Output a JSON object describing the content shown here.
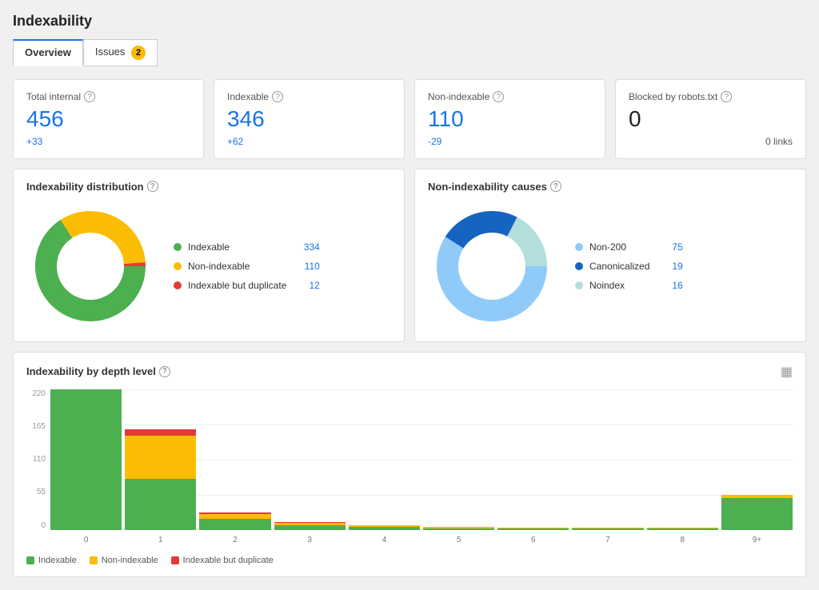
{
  "page": {
    "title": "Indexability"
  },
  "tabs": [
    {
      "id": "overview",
      "label": "Overview",
      "active": true,
      "badge": null
    },
    {
      "id": "issues",
      "label": "Issues",
      "active": false,
      "badge": "2"
    }
  ],
  "metrics": [
    {
      "id": "total-internal",
      "label": "Total internal",
      "value": "456",
      "change": "+33",
      "change_type": "positive",
      "sub": null
    },
    {
      "id": "indexable",
      "label": "Indexable",
      "value": "346",
      "change": "+62",
      "change_type": "positive",
      "sub": null
    },
    {
      "id": "non-indexable",
      "label": "Non-indexable",
      "value": "110",
      "change": "-29",
      "change_type": "negative",
      "sub": null
    },
    {
      "id": "blocked-by-robots",
      "label": "Blocked by robots.txt",
      "value": "0",
      "change": null,
      "change_type": null,
      "sub": "0 links"
    }
  ],
  "indexability_distribution": {
    "title": "Indexability distribution",
    "legend": [
      {
        "label": "Indexable",
        "value": "334",
        "color": "#4caf50"
      },
      {
        "label": "Non-indexable",
        "value": "110",
        "color": "#fbbc04"
      },
      {
        "label": "Indexable but duplicate",
        "value": "12",
        "color": "#e53935"
      }
    ],
    "donut": {
      "indexable_pct": 73.6,
      "non_indexable_pct": 24.2,
      "duplicate_pct": 2.6
    }
  },
  "non_indexability_causes": {
    "title": "Non-indexability causes",
    "legend": [
      {
        "label": "Non-200",
        "value": "75",
        "color": "#90caf9"
      },
      {
        "label": "Canonicalized",
        "value": "19",
        "color": "#1565c0"
      },
      {
        "label": "Noindex",
        "value": "16",
        "color": "#b2dfdb"
      }
    ],
    "donut": {
      "non200_pct": 68.2,
      "canonicalized_pct": 17.3,
      "noindex_pct": 14.5
    }
  },
  "bar_chart": {
    "title": "Indexability by depth level",
    "y_labels": [
      "220",
      "165",
      "110",
      "55",
      "0"
    ],
    "x_labels": [
      "0",
      "1",
      "2",
      "3",
      "4",
      "5",
      "6",
      "7",
      "8",
      "9+"
    ],
    "bars": [
      {
        "label": "0",
        "indexable": 220,
        "non_indexable": 0,
        "duplicate": 0
      },
      {
        "label": "1",
        "indexable": 80,
        "non_indexable": 68,
        "duplicate": 10
      },
      {
        "label": "2",
        "indexable": 18,
        "non_indexable": 8,
        "duplicate": 2
      },
      {
        "label": "3",
        "indexable": 8,
        "non_indexable": 4,
        "duplicate": 1
      },
      {
        "label": "4",
        "indexable": 5,
        "non_indexable": 3,
        "duplicate": 0
      },
      {
        "label": "5",
        "indexable": 3,
        "non_indexable": 2,
        "duplicate": 0
      },
      {
        "label": "6",
        "indexable": 2,
        "non_indexable": 1,
        "duplicate": 0
      },
      {
        "label": "7",
        "indexable": 2,
        "non_indexable": 1,
        "duplicate": 0
      },
      {
        "label": "8",
        "indexable": 2,
        "non_indexable": 1,
        "duplicate": 0
      },
      {
        "label": "9+",
        "indexable": 50,
        "non_indexable": 5,
        "duplicate": 0
      }
    ],
    "max_value": 220,
    "legend": [
      {
        "label": "Indexable",
        "color": "#4caf50"
      },
      {
        "label": "Non-indexable",
        "color": "#fbbc04"
      },
      {
        "label": "Indexable but duplicate",
        "color": "#e53935"
      }
    ]
  },
  "colors": {
    "green": "#4caf50",
    "yellow": "#fbbc04",
    "red": "#e53935",
    "blue_light": "#90caf9",
    "blue_dark": "#1565c0",
    "teal_light": "#b2dfdb",
    "accent": "#1a73e8"
  }
}
